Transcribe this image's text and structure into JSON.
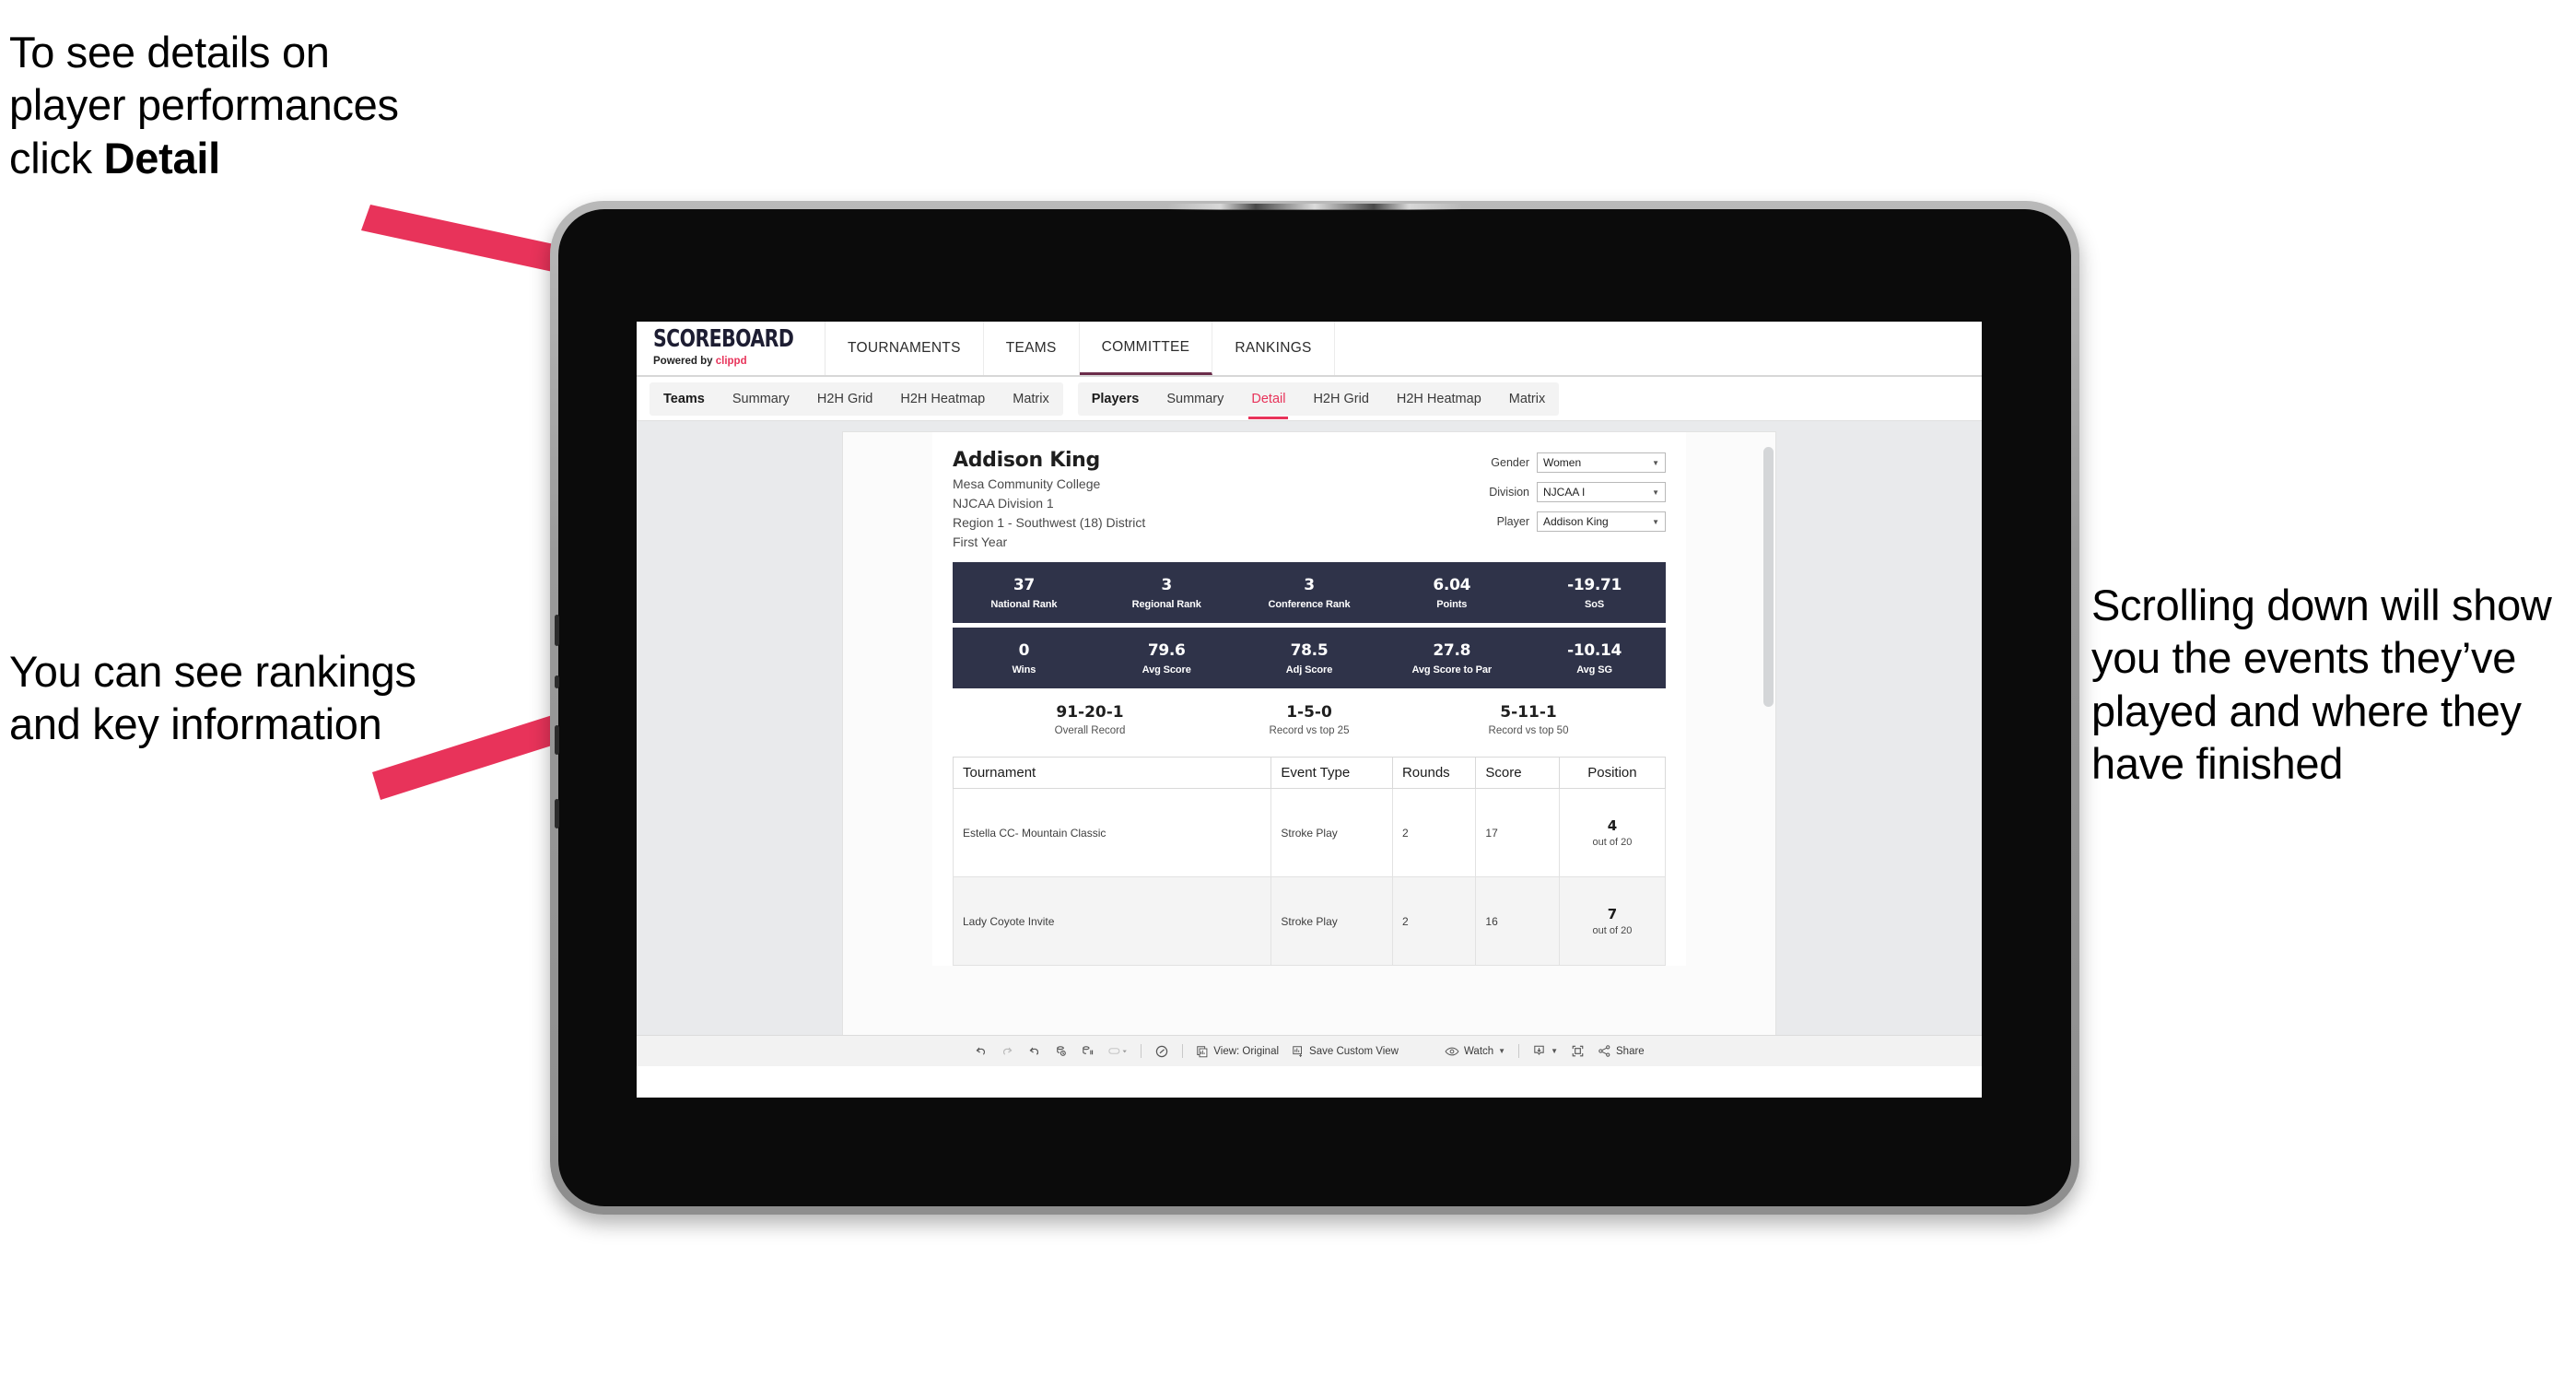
{
  "annotations": {
    "detail_note_line1": "To see details on",
    "detail_note_line2": "player performances",
    "detail_note_line3_prefix": "click ",
    "detail_note_line3_bold": "Detail",
    "rankings_note": "You can see rankings and key information",
    "scroll_note": "Scrolling down will show you the events they’ve played and where they have finished"
  },
  "app": {
    "brand": {
      "title": "SCOREBOARD",
      "powered_prefix": "Powered by ",
      "powered_brand": "clippd"
    },
    "top_nav": [
      {
        "label": "TOURNAMENTS",
        "active": false
      },
      {
        "label": "TEAMS",
        "active": false
      },
      {
        "label": "COMMITTEE",
        "active": true
      },
      {
        "label": "RANKINGS",
        "active": false
      }
    ],
    "tab_groups": [
      {
        "head": "Teams",
        "tabs": [
          "Summary",
          "H2H Grid",
          "H2H Heatmap",
          "Matrix"
        ],
        "active": null
      },
      {
        "head": "Players",
        "tabs": [
          "Summary",
          "Detail",
          "H2H Grid",
          "H2H Heatmap",
          "Matrix"
        ],
        "active": "Detail"
      }
    ]
  },
  "player": {
    "name": "Addison King",
    "school": "Mesa Community College",
    "division": "NJCAA Division 1",
    "region": "Region 1 - Southwest (18) District",
    "year": "First Year"
  },
  "filters": [
    {
      "label": "Gender",
      "value": "Women"
    },
    {
      "label": "Division",
      "value": "NJCAA I"
    },
    {
      "label": "Player",
      "value": "Addison King"
    }
  ],
  "stats_band_1": [
    {
      "value": "37",
      "label": "National Rank"
    },
    {
      "value": "3",
      "label": "Regional Rank"
    },
    {
      "value": "3",
      "label": "Conference Rank"
    },
    {
      "value": "6.04",
      "label": "Points"
    },
    {
      "value": "-19.71",
      "label": "SoS"
    }
  ],
  "stats_band_2": [
    {
      "value": "0",
      "label": "Wins"
    },
    {
      "value": "79.6",
      "label": "Avg Score"
    },
    {
      "value": "78.5",
      "label": "Adj Score"
    },
    {
      "value": "27.8",
      "label": "Avg Score to Par"
    },
    {
      "value": "-10.14",
      "label": "Avg SG"
    }
  ],
  "records": [
    {
      "value": "91-20-1",
      "label": "Overall Record"
    },
    {
      "value": "1-5-0",
      "label": "Record vs top 25"
    },
    {
      "value": "5-11-1",
      "label": "Record vs top 50"
    }
  ],
  "events_table": {
    "columns": [
      "Tournament",
      "Event Type",
      "Rounds",
      "Score",
      "Position"
    ],
    "rows": [
      {
        "tournament": "Estella CC- Mountain Classic",
        "event_type": "Stroke Play",
        "rounds": "2",
        "score": "17",
        "position": "4",
        "position_sub": "out of 20"
      },
      {
        "tournament": "Lady Coyote Invite",
        "event_type": "Stroke Play",
        "rounds": "2",
        "score": "16",
        "position": "7",
        "position_sub": "out of 20"
      }
    ]
  },
  "bottom_toolbar": {
    "view_label": "View: Original",
    "save_label": "Save Custom View",
    "watch_label": "Watch",
    "share_label": "Share"
  },
  "colors": {
    "accent_pink": "#e8335a",
    "stat_band": "#2f3349",
    "topnav_active_underline": "#6b2c4a",
    "canvas_bg": "#e9eaec"
  }
}
